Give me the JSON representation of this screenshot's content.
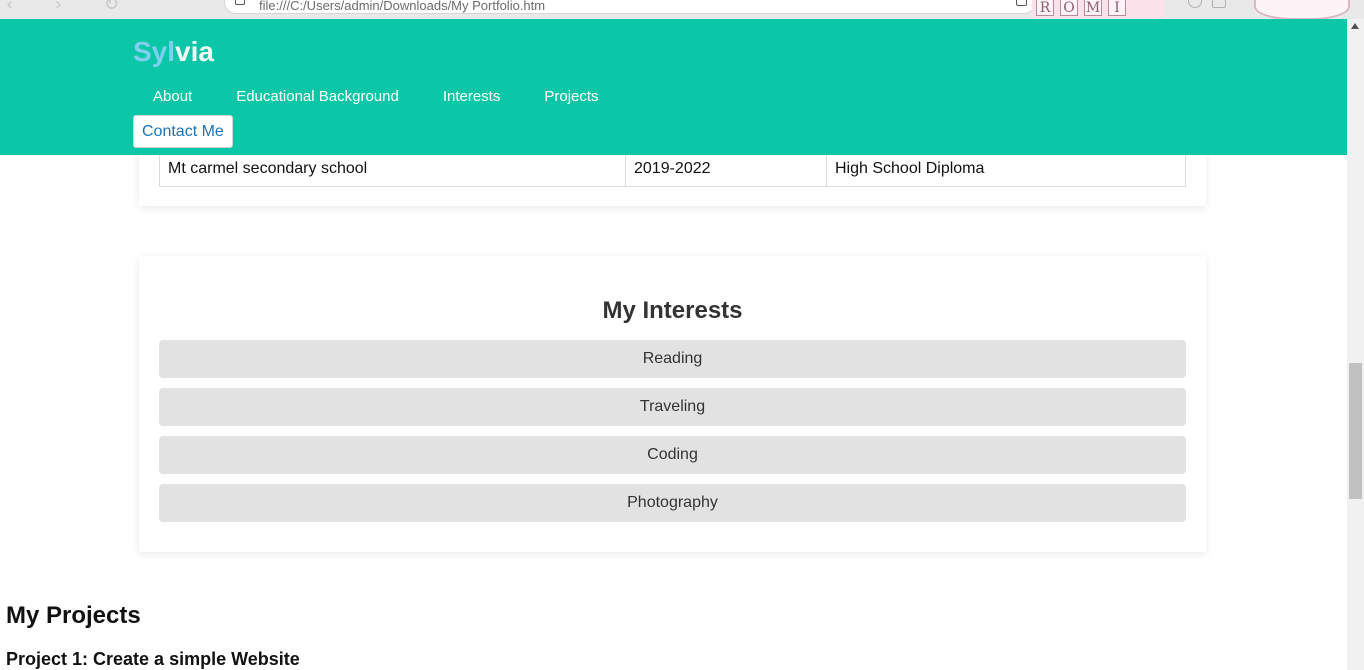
{
  "browser": {
    "url": "file:///C:/Users/admin/Downloads/My Portfolio.htm",
    "nav_icons": "‹ › ↻",
    "tab_decor_letters": [
      "R",
      "O",
      "M",
      "I"
    ]
  },
  "header": {
    "brand_part1": "Syl",
    "brand_part2": "via",
    "nav": [
      "About",
      "Educational Background",
      "Interests",
      "Projects"
    ],
    "contact_label": "Contact Me",
    "colors": {
      "header_bg": "#0cc7a7",
      "brand_accent": "#7fd0ee",
      "contact_text": "#1a73b5"
    }
  },
  "education": {
    "rows": [
      [
        "Mt carmel secondary school",
        "2019-2022",
        "High School Diploma"
      ]
    ]
  },
  "interests": {
    "title": "My Interests",
    "items": [
      "Reading",
      "Traveling",
      "Coding",
      "Photography"
    ]
  },
  "projects": {
    "title": "My Projects",
    "items": [
      "Project 1: Create a simple Website"
    ]
  }
}
